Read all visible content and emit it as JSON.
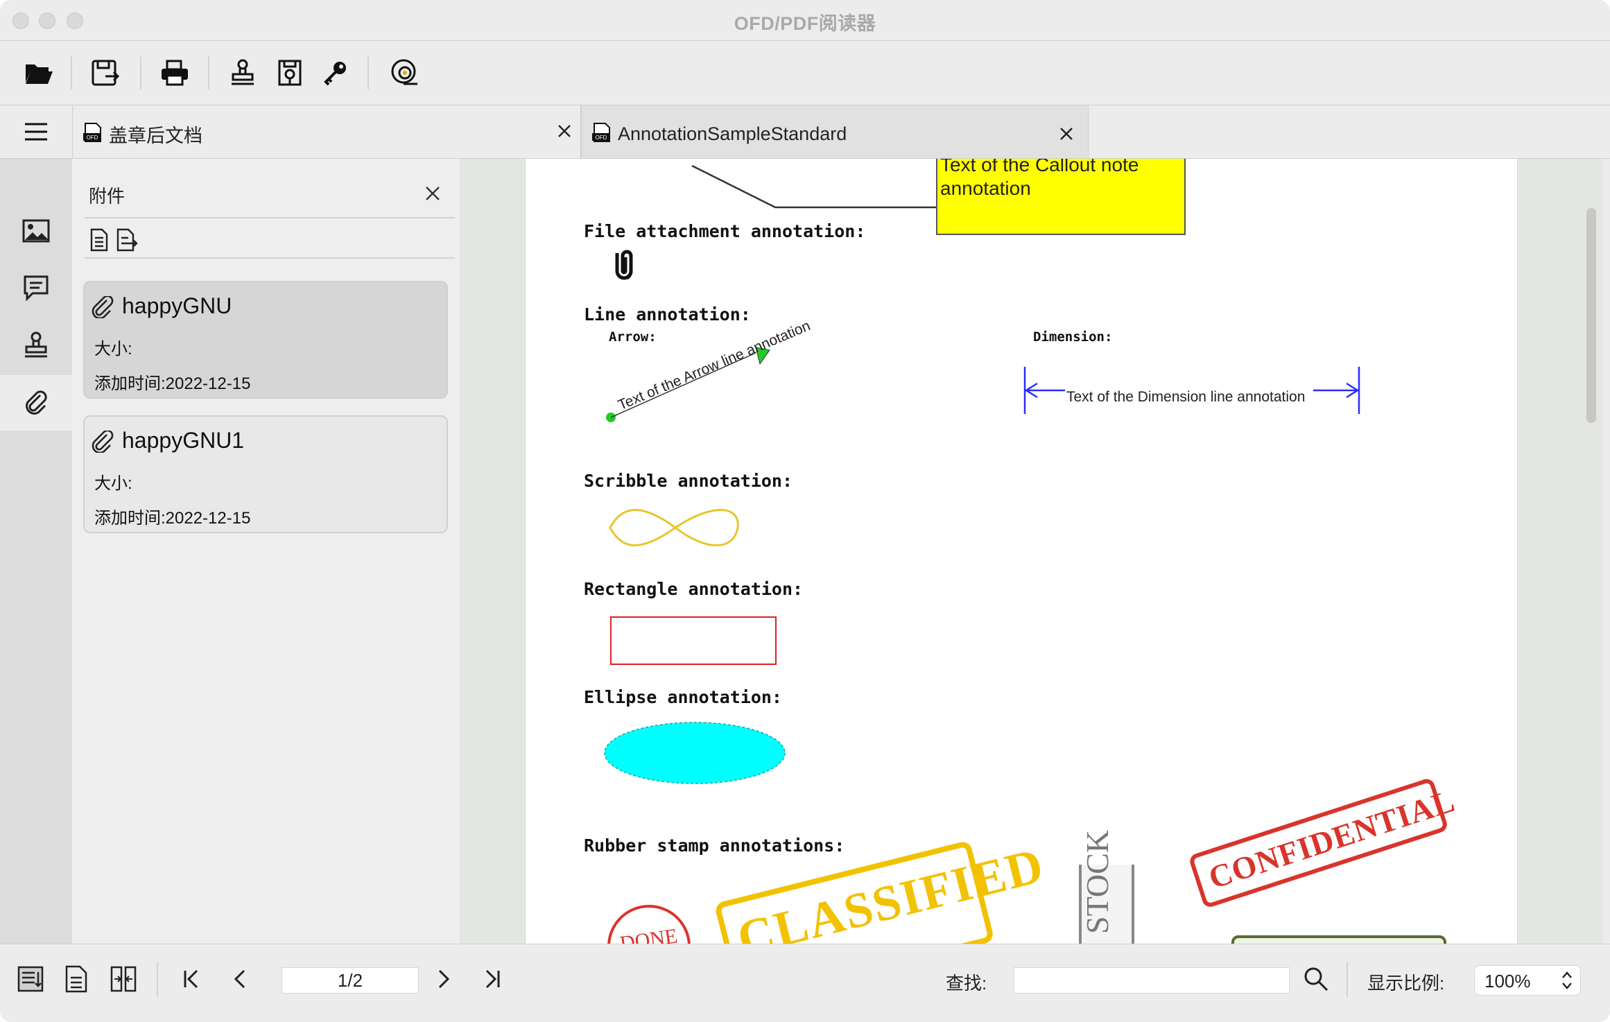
{
  "window": {
    "title": "OFD/PDF阅读器"
  },
  "toolbar": {
    "buttons": [
      {
        "name": "open-folder"
      },
      {
        "name": "save-as"
      },
      {
        "name": "print"
      },
      {
        "name": "stamp"
      },
      {
        "name": "verify-seal"
      },
      {
        "name": "key"
      },
      {
        "name": "signature-verify"
      }
    ]
  },
  "tabs": [
    {
      "label": "盖章后文档",
      "icon": "ofd-file-icon",
      "active": false
    },
    {
      "label": "AnnotationSampleStandard",
      "icon": "ofd-file-icon",
      "active": true
    }
  ],
  "left_rail": {
    "items": [
      "image-icon",
      "comment-icon",
      "stamp-icon",
      "paperclip-icon"
    ],
    "active": 3
  },
  "attachments_panel": {
    "title": "附件",
    "attachments": [
      {
        "name": "happyGNU",
        "size_label": "大小:",
        "date_label": "添加时间:2022-12-15"
      },
      {
        "name": "happyGNU1",
        "size_label": "大小:",
        "date_label": "添加时间:2022-12-15"
      }
    ]
  },
  "document": {
    "callout_text": "Text of the Callout note annotation",
    "file_attachment_label": "File attachment annotation:",
    "line_label": "Line annotation:",
    "arrow_label": "Arrow:",
    "arrow_text": "Text of the Arrow line annotation",
    "dimension_label": "Dimension:",
    "dimension_text": "Text of the Dimension line annotation",
    "scribble_label": "Scribble annotation:",
    "rectangle_label": "Rectangle annotation:",
    "ellipse_label": "Ellipse annotation:",
    "rubber_stamp_label": "Rubber stamp annotations:",
    "stamp_confidential": "CONFIDENTIAL",
    "stamp_classified": "CLASSIFIED",
    "stamp_stock": "STOCK",
    "stamp_done": "DONE",
    "colors": {
      "callout": "#ffff00",
      "scribble": "#e6c62e",
      "rectangle": "#e02020",
      "ellipse": "#00ffff",
      "arrow": "#22cc22",
      "dimension": "#2b2bff",
      "confidential": "#d9342b",
      "classified": "#f2c200"
    }
  },
  "statusbar": {
    "page_value": "1/2",
    "search_label": "查找:",
    "search_value": "",
    "zoom_label": "显示比例:",
    "zoom_value": "100%"
  }
}
